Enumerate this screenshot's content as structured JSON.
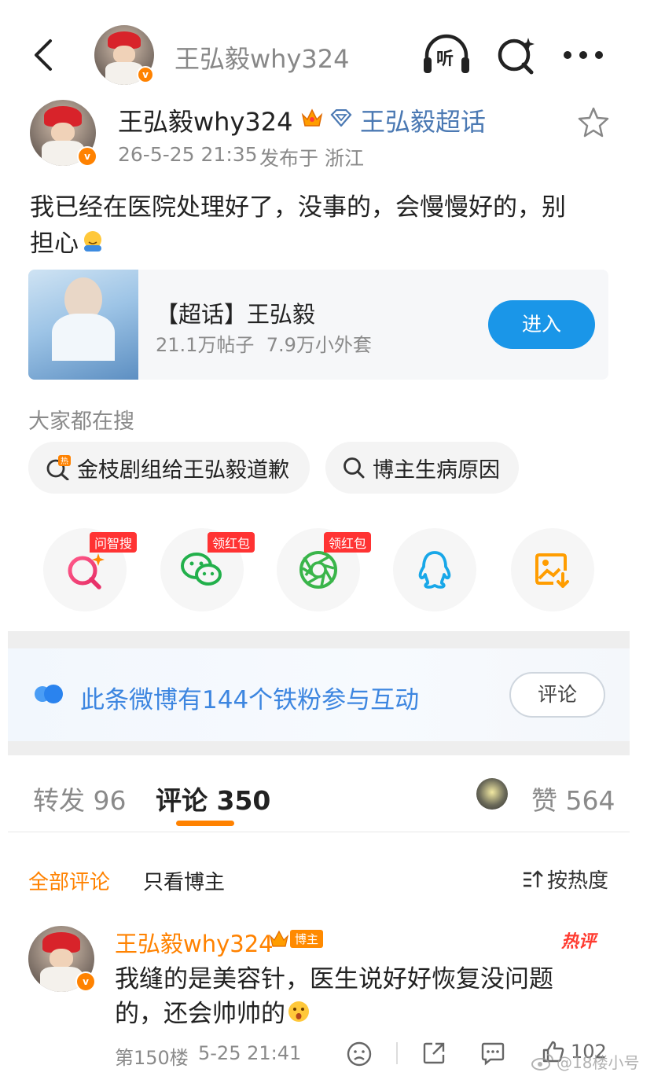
{
  "colors": {
    "accent_orange": "#ff8200",
    "link_blue": "#4b79b3",
    "button_blue": "#1a96e8",
    "gray_text": "#8a8a8a"
  },
  "nav": {
    "back_icon": "chevron-left-icon",
    "title": "王弘毅why324",
    "listen_label": "听",
    "search_icon": "ai-search-icon",
    "more_icon": "more-dots-icon"
  },
  "post": {
    "author": "王弘毅why324",
    "supertopic_link": "王弘毅超话",
    "time": "26-5-25 21:35",
    "location": "发布于 浙江",
    "text_line1": "我已经在医院处理好了，没事的，会慢慢好的，别",
    "text_line2": "担心",
    "emoji": "hug-emoji"
  },
  "card": {
    "title": "【超话】王弘毅",
    "stats": "21.1万帖子  7.9万小外套",
    "button": "进入"
  },
  "search": {
    "heading": "大家都在搜",
    "chips": [
      {
        "label": "金枝剧组给王弘毅道歉",
        "icon": "hot-search-icon"
      },
      {
        "label": "博主生病原因",
        "icon": "search-icon"
      }
    ]
  },
  "share": {
    "items": [
      {
        "tag": "问智搜",
        "icon": "ai-search-icon"
      },
      {
        "tag": "领红包",
        "icon": "wechat-icon"
      },
      {
        "tag": "领红包",
        "icon": "moments-icon"
      },
      {
        "tag": "",
        "icon": "qq-icon"
      },
      {
        "tag": "",
        "icon": "save-image-icon"
      }
    ]
  },
  "fans_banner": {
    "text": "此条微博有144个铁粉参与互动",
    "button": "评论"
  },
  "tabs": {
    "repost": "转发 96",
    "comments": "评论 350",
    "likes": "赞 564"
  },
  "filter": {
    "all": "全部评论",
    "author_only": "只看博主",
    "sort": "按热度"
  },
  "comment": {
    "author": "王弘毅why324",
    "badge": "博主",
    "hot_label": "热评",
    "text_line1": "我缝的是美容针，医生说好好恢复没问题",
    "text_line2": "的，还会帅帅的",
    "floor": "第150楼",
    "time": "5-25 21:41",
    "like_count": "102"
  },
  "watermark": "@18楼小号"
}
